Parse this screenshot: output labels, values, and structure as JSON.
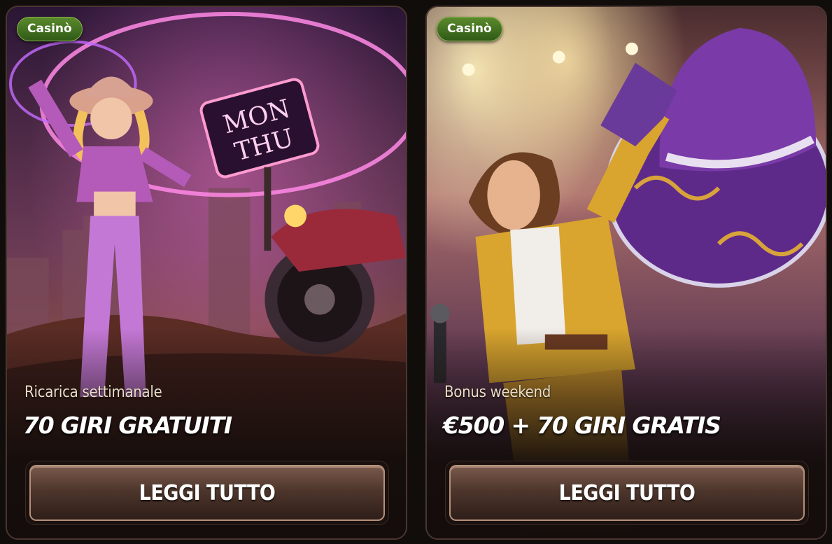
{
  "cards": [
    {
      "badge": "Casinò",
      "subtitle": "Ricarica settimanale",
      "headline": "70 GIRI GRATUITI",
      "button_label": "LEGGI TUTTO",
      "sign_text_line1": "MON",
      "sign_text_line2": "THU"
    },
    {
      "badge": "Casinò",
      "subtitle": "Bonus weekend",
      "headline": "€500 + 70 GIRI GRATIS",
      "button_label": "LEGGI TUTTO"
    }
  ],
  "colors": {
    "badge_green": "#4b7a22",
    "button_border": "#b48f79",
    "page_bg": "#110d0b"
  }
}
